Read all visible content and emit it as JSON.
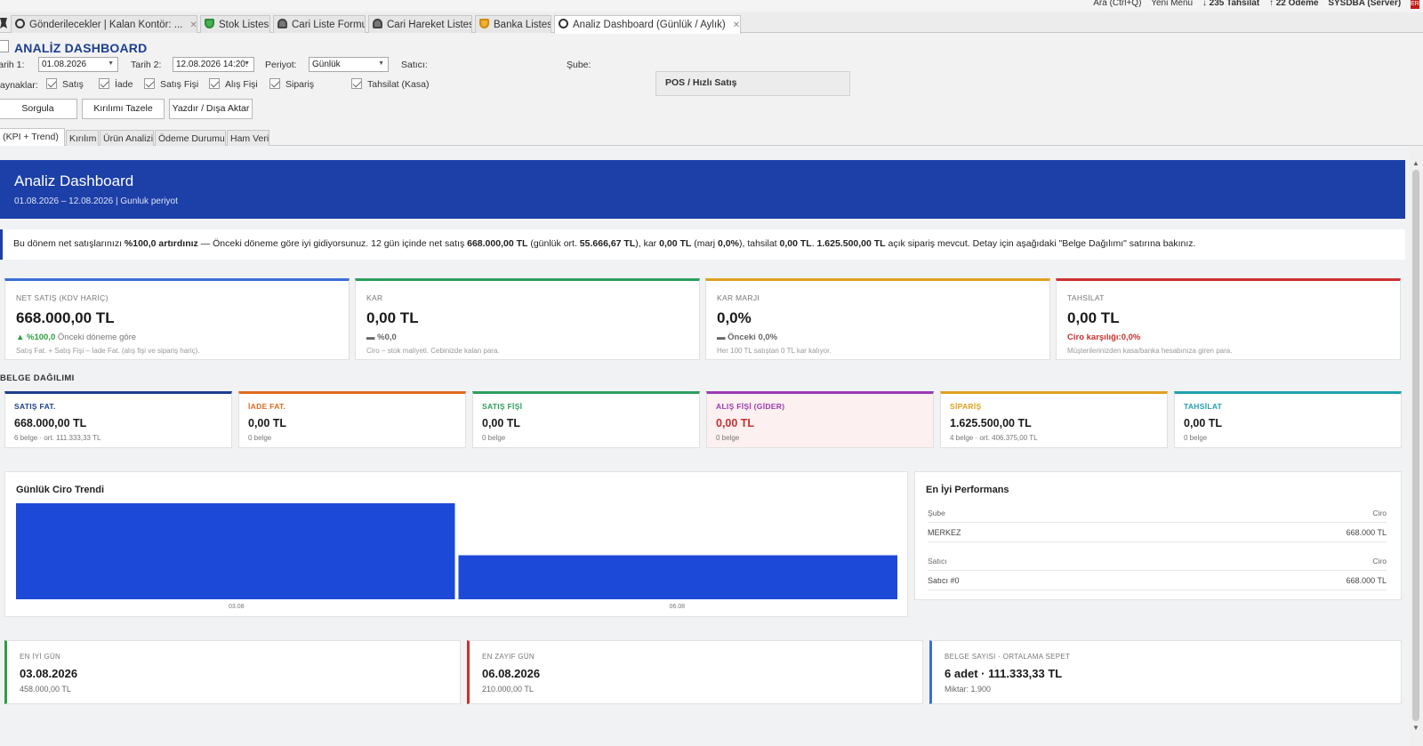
{
  "status_bar": {
    "search": "Ara  (Ctrl+Q)",
    "new_menu": "Yeni Menü",
    "collections": "↓ 235 Tahsilat",
    "payments": "↑ 22 Ödeme",
    "user": "SYSDBA (Server)",
    "flag": "ER"
  },
  "tabs": [
    {
      "label": "Gönderilecekler  |  Kalan Kontör: ...",
      "icon": "clock-icon"
    },
    {
      "label": "Stok Listesi",
      "icon": "shield-icon"
    },
    {
      "label": "Cari Liste Formu",
      "icon": "person-icon"
    },
    {
      "label": "Cari Hareket Listesi",
      "icon": "person-icon"
    },
    {
      "label": "Banka Listesi",
      "icon": "shield-icon"
    },
    {
      "label": "Analiz Dashboard (Günlük / Aylık)",
      "icon": "clock-icon"
    }
  ],
  "header": {
    "title": "ANALİZ DASHBOARD",
    "date1_label": "Tarih 1:",
    "date1_value": "01.08.2026",
    "date2_label": "Tarih 2:",
    "date2_value": "12.08.2026 14:20:",
    "period_label": "Periyot:",
    "period_value": "Günlük",
    "seller_label": "Satıcı:",
    "branch_label": "Şube:",
    "sources_label": "Kaynaklar:",
    "sources": [
      "Satış",
      "İade",
      "Satış Fişi",
      "Alış Fişi",
      "Sipariş",
      "Tahsilat (Kasa)"
    ],
    "buttons": {
      "query": "Sorgula",
      "refresh": "Kırılımı Tazele",
      "print": "Yazdır / Dışa Aktar"
    },
    "pos_panel": "POS / Hızlı Satış"
  },
  "subtabs": [
    "Özet (KPI + Trend)",
    "Kırılım",
    "Ürün Analizi",
    "Ödeme Durumu",
    "Ham Veri"
  ],
  "hero": {
    "title": "Analiz Dashboard",
    "subtitle": "01.08.2026 – 12.08.2026  |  Gunluk periyot"
  },
  "summary": {
    "p1": "Bu dönem net satışlarınızı ",
    "b1": "%100,0 artırdınız",
    "p2": " — Önceki döneme göre iyi gidiyorsunuz. 12 gün içinde net satış ",
    "b2": "668.000,00 TL",
    "p3": " (günlük ort. ",
    "b3": "55.666,67 TL",
    "p4": "), kar ",
    "b4": "0,00 TL",
    "p5": " (marj ",
    "b5": "0,0%",
    "p6": "), tahsilat ",
    "b6": "0,00 TL",
    "p7": ". ",
    "b7": "1.625.500,00 TL",
    "p8": " açık sipariş mevcut. Detay için aşağıdaki \"Belge Dağılımı\" satırına bakınız."
  },
  "kpis": [
    {
      "label": "NET SATIŞ (KDV HARİÇ)",
      "value": "668.000,00 TL",
      "delta": "▲ %100,0",
      "delta_note": " Önceki döneme göre",
      "desc": "Satış Fat. + Satış Fişi – İade Fat. (alış fişi ve sipariş hariç).",
      "color": "#3a6fd8",
      "delta_color": "#2e9e3e"
    },
    {
      "label": "KAR",
      "value": "0,00 TL",
      "delta": "▬ %0,0",
      "delta_note": "",
      "desc": "Ciro − stok maliyeti. Cebinizde kalan para.",
      "color": "#2e9e5e",
      "delta_color": "#666"
    },
    {
      "label": "KAR MARJI",
      "value": "0,0%",
      "delta": "▬ Önceki 0,0%",
      "delta_note": "",
      "desc": "Her 100 TL satıştan 0 TL kar kalıyor.",
      "color": "#e0a020",
      "delta_color": "#666"
    },
    {
      "label": "TAHSİLAT",
      "value": "0,00 TL",
      "delta": "Ciro karşılığı:0,0%",
      "delta_note": "",
      "desc": "Müşterilerinizden kasa/banka hesabınıza giren para.",
      "color": "#d03030",
      "delta_color": "#c83030"
    }
  ],
  "section_title": "BELGE DAĞILIMI",
  "doc_cards": [
    {
      "label": "SATIŞ FAT.",
      "value": "668.000,00 TL",
      "sub": "6 belge · ort. 111.333,33 TL",
      "color": "#1c3f8f",
      "bg": "#ffffff",
      "value_color": "#1a1a1a"
    },
    {
      "label": "İADE FAT.",
      "value": "0,00 TL",
      "sub": "0 belge",
      "color": "#e06a20",
      "bg": "#ffffff",
      "value_color": "#1a1a1a"
    },
    {
      "label": "SATIŞ FİŞİ",
      "value": "0,00 TL",
      "sub": "0 belge",
      "color": "#2e9e5e",
      "bg": "#ffffff",
      "value_color": "#1a1a1a"
    },
    {
      "label": "ALIŞ FİŞİ (GİDER)",
      "value": "0,00 TL",
      "sub": "0 belge",
      "color": "#9a3ab0",
      "bg": "#fdf0f0",
      "value_color": "#c83030"
    },
    {
      "label": "SİPARİŞ",
      "value": "1.625.500,00 TL",
      "sub": "4 belge · ort. 406.375,00 TL",
      "color": "#e0a020",
      "bg": "#ffffff",
      "value_color": "#1a1a1a"
    },
    {
      "label": "TAHSİLAT",
      "value": "0,00 TL",
      "sub": "0 belge",
      "color": "#20a0b0",
      "bg": "#ffffff",
      "value_color": "#1a1a1a"
    }
  ],
  "chart_data": {
    "type": "bar",
    "title": "Günlük Ciro Trendi",
    "categories": [
      "03.08",
      "06.08"
    ],
    "values": [
      458000,
      210000
    ],
    "ylim": [
      0,
      458000
    ],
    "color": "#1c49d8",
    "grid": false,
    "legend": "none"
  },
  "performance": {
    "title": "En İyi Performans",
    "branch_header": "Şube",
    "seller_header": "Satıcı",
    "revenue_header": "Ciro",
    "branch_rows": [
      {
        "name": "MERKEZ",
        "value": "668.000 TL"
      }
    ],
    "seller_rows": [
      {
        "name": "Satıcı #0",
        "value": "668.000 TL"
      }
    ]
  },
  "stats": [
    {
      "label": "EN İYİ GÜN",
      "value": "03.08.2026",
      "sub": "458.000,00 TL",
      "color": "#2e9e3e"
    },
    {
      "label": "EN ZAYIF GÜN",
      "value": "06.08.2026",
      "sub": "210.000,00 TL",
      "color": "#c83030"
    },
    {
      "label": "BELGE SAYISI · ORTALAMA SEPET",
      "value": "6 adet · 111.333,33 TL",
      "sub": "Miktar: 1.900",
      "color": "#3a6fd8"
    }
  ]
}
